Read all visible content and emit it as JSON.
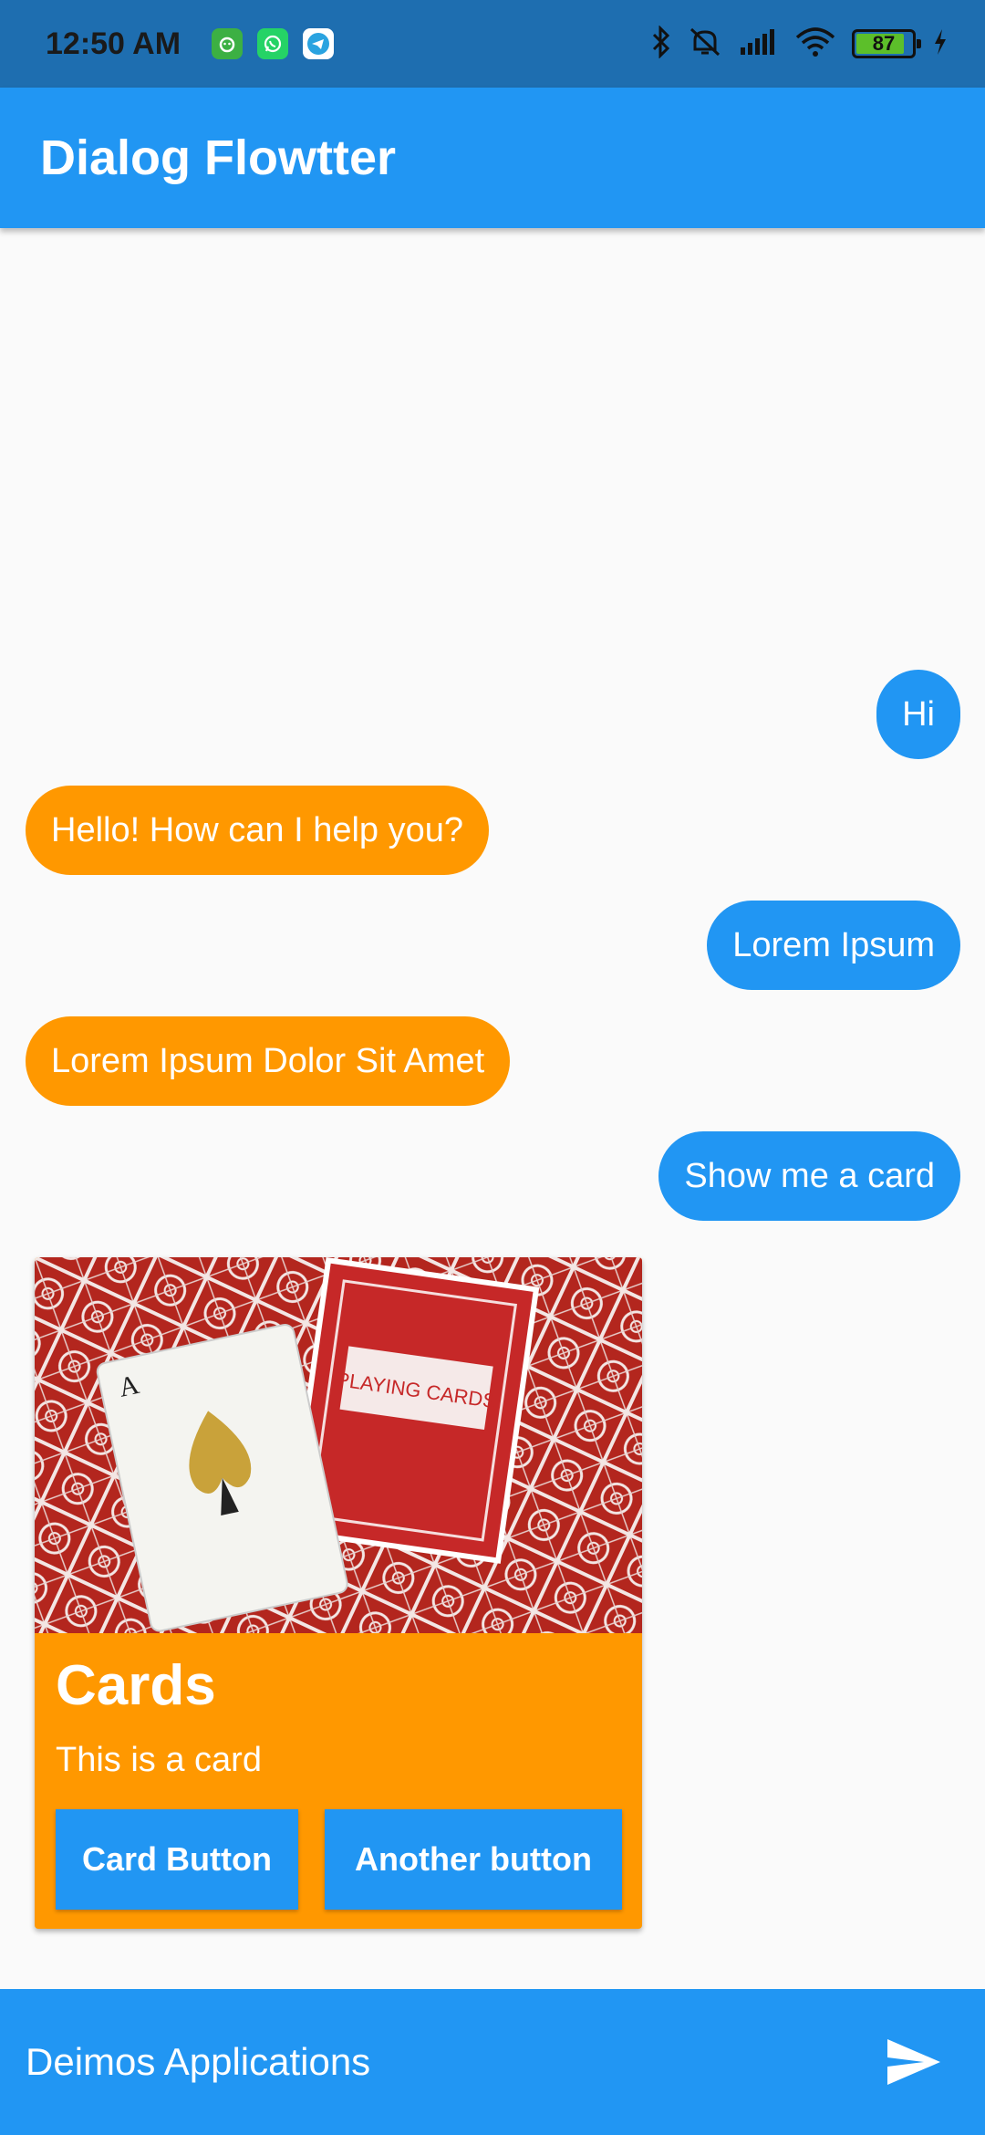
{
  "status_bar": {
    "time": "12:50 AM",
    "battery_level": "87",
    "battery_fraction": 0.87,
    "icons": [
      "app-notification-icon",
      "whatsapp-icon",
      "telegram-icon",
      "bluetooth-icon",
      "mute-icon",
      "signal-icon",
      "wifi-icon",
      "battery-icon",
      "charging-icon"
    ]
  },
  "app_bar": {
    "title": "Dialog Flowtter"
  },
  "messages": [
    {
      "from": "user",
      "text": "Hi"
    },
    {
      "from": "bot",
      "text": "Hello! How can I help you?"
    },
    {
      "from": "user",
      "text": "Lorem Ipsum"
    },
    {
      "from": "bot",
      "text": "Lorem Ipsum Dolor Sit Amet"
    },
    {
      "from": "user",
      "text": "Show me a card"
    }
  ],
  "card": {
    "image": "playing-cards-photo",
    "title": "Cards",
    "subtitle": "This is a card",
    "buttons": [
      {
        "label": "Card Button"
      },
      {
        "label": "Another button"
      }
    ]
  },
  "input_bar": {
    "value": "Deimos Applications",
    "send_icon": "send-icon"
  },
  "colors": {
    "primary": "#2196f3",
    "status_bar": "#1e6eb0",
    "bot_bubble": "#ff9800",
    "background": "#fafafa",
    "battery_fill": "#5cbf2a"
  }
}
